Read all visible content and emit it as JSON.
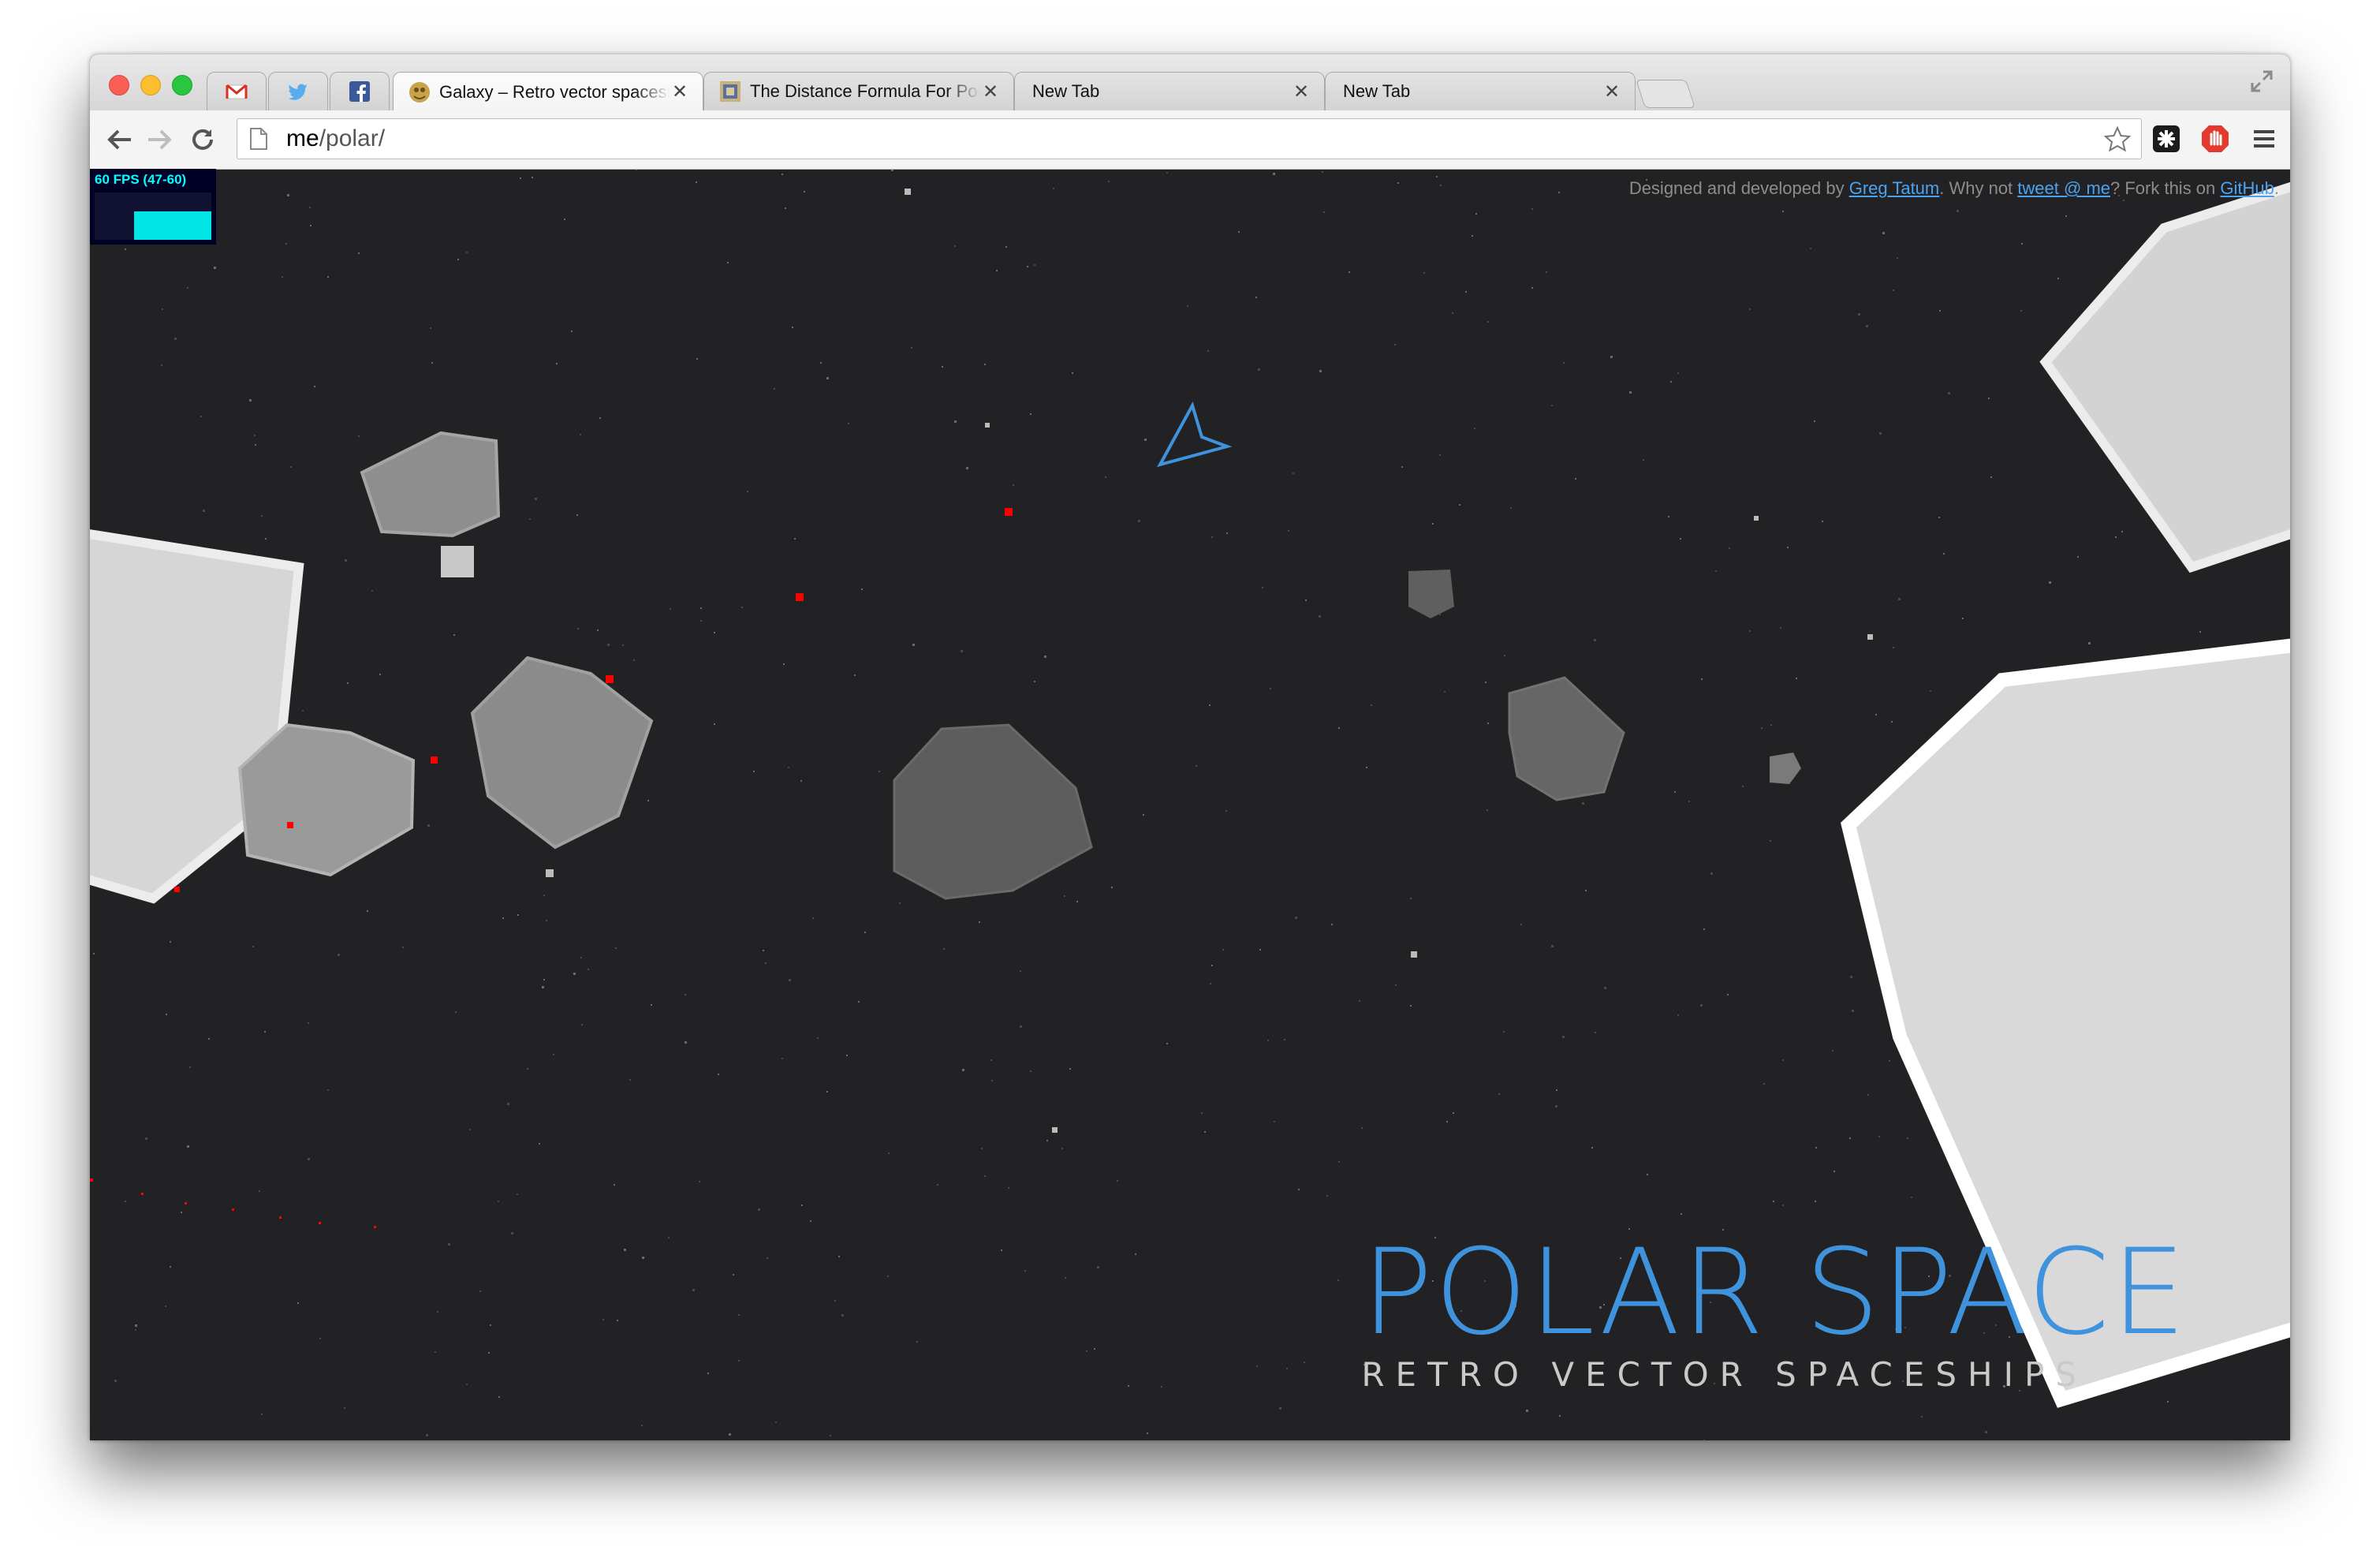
{
  "tabs": [
    {
      "type": "pinned",
      "icon": "gmail-icon",
      "label": ""
    },
    {
      "type": "pinned",
      "icon": "twitter-icon",
      "label": ""
    },
    {
      "type": "pinned",
      "icon": "facebook-icon",
      "label": ""
    },
    {
      "type": "normal",
      "icon": "galaxy-favicon",
      "label": "Galaxy – Retro vector spaceships",
      "active": true
    },
    {
      "type": "normal",
      "icon": "distance-favicon",
      "label": "The Distance Formula For Points"
    },
    {
      "type": "normal",
      "icon": "",
      "label": "New Tab"
    },
    {
      "type": "normal",
      "icon": "",
      "label": "New Tab"
    }
  ],
  "omnibox": {
    "host": "me",
    "path": "/polar/"
  },
  "fps": {
    "label": "60 FPS (47-60)",
    "level_pct": 60
  },
  "credits": {
    "prefix": "Designed and developed by ",
    "author": "Greg Tatum",
    "mid": ". Why not ",
    "tweet": "tweet @ me",
    "mid2": "? Fork this on ",
    "github": "GitHub",
    "suffix": "."
  },
  "brand": {
    "title": "POLAR SPACE",
    "subtitle": "RETRO VECTOR SPACESHIPS"
  },
  "colors": {
    "accent": "#3f93dd",
    "background": "#222224",
    "bullet": "#ff0000",
    "asteroid_light": "#d8d8d8",
    "asteroid_dark": "#555555",
    "ship": "#3f93dd"
  }
}
